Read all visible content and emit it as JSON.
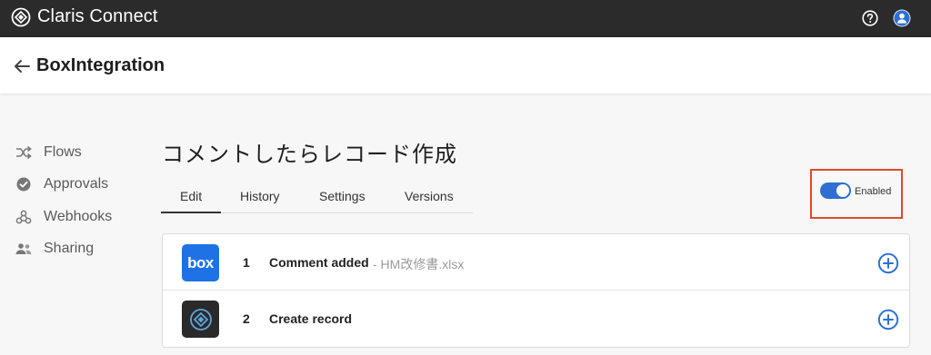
{
  "app": {
    "brand_name": "Claris Connect",
    "logo_icon": "claris-logo-icon",
    "help_icon": "help-icon",
    "user_icon": "user-avatar-icon"
  },
  "header": {
    "back_icon": "arrow-left-icon",
    "title": "BoxIntegration"
  },
  "sidebar": {
    "items": [
      {
        "label": "Flows",
        "icon": "shuffle-icon"
      },
      {
        "label": "Approvals",
        "icon": "check-circle-icon"
      },
      {
        "label": "Webhooks",
        "icon": "webhook-icon"
      },
      {
        "label": "Sharing",
        "icon": "people-icon"
      }
    ]
  },
  "flow": {
    "title": "コメントしたらレコード作成",
    "tabs": [
      {
        "label": "Edit",
        "active": true
      },
      {
        "label": "History",
        "active": false
      },
      {
        "label": "Settings",
        "active": false
      },
      {
        "label": "Versions",
        "active": false
      }
    ],
    "enabled": {
      "label": "Enabled",
      "value": true
    }
  },
  "steps": [
    {
      "number": "1",
      "title": "Comment added",
      "detail": "- HM改修書.xlsx",
      "app_label": "box",
      "app_icon": "box-app-icon",
      "add_icon": "add-circle-icon"
    },
    {
      "number": "2",
      "title": "Create record",
      "detail": "",
      "app_label": "",
      "app_icon": "claris-app-icon",
      "add_icon": "add-circle-icon"
    }
  ],
  "colors": {
    "topbar": "#2b2b2b",
    "accent": "#2f6fd2",
    "highlight": "#e0492c",
    "box_brand": "#1f72e6"
  }
}
